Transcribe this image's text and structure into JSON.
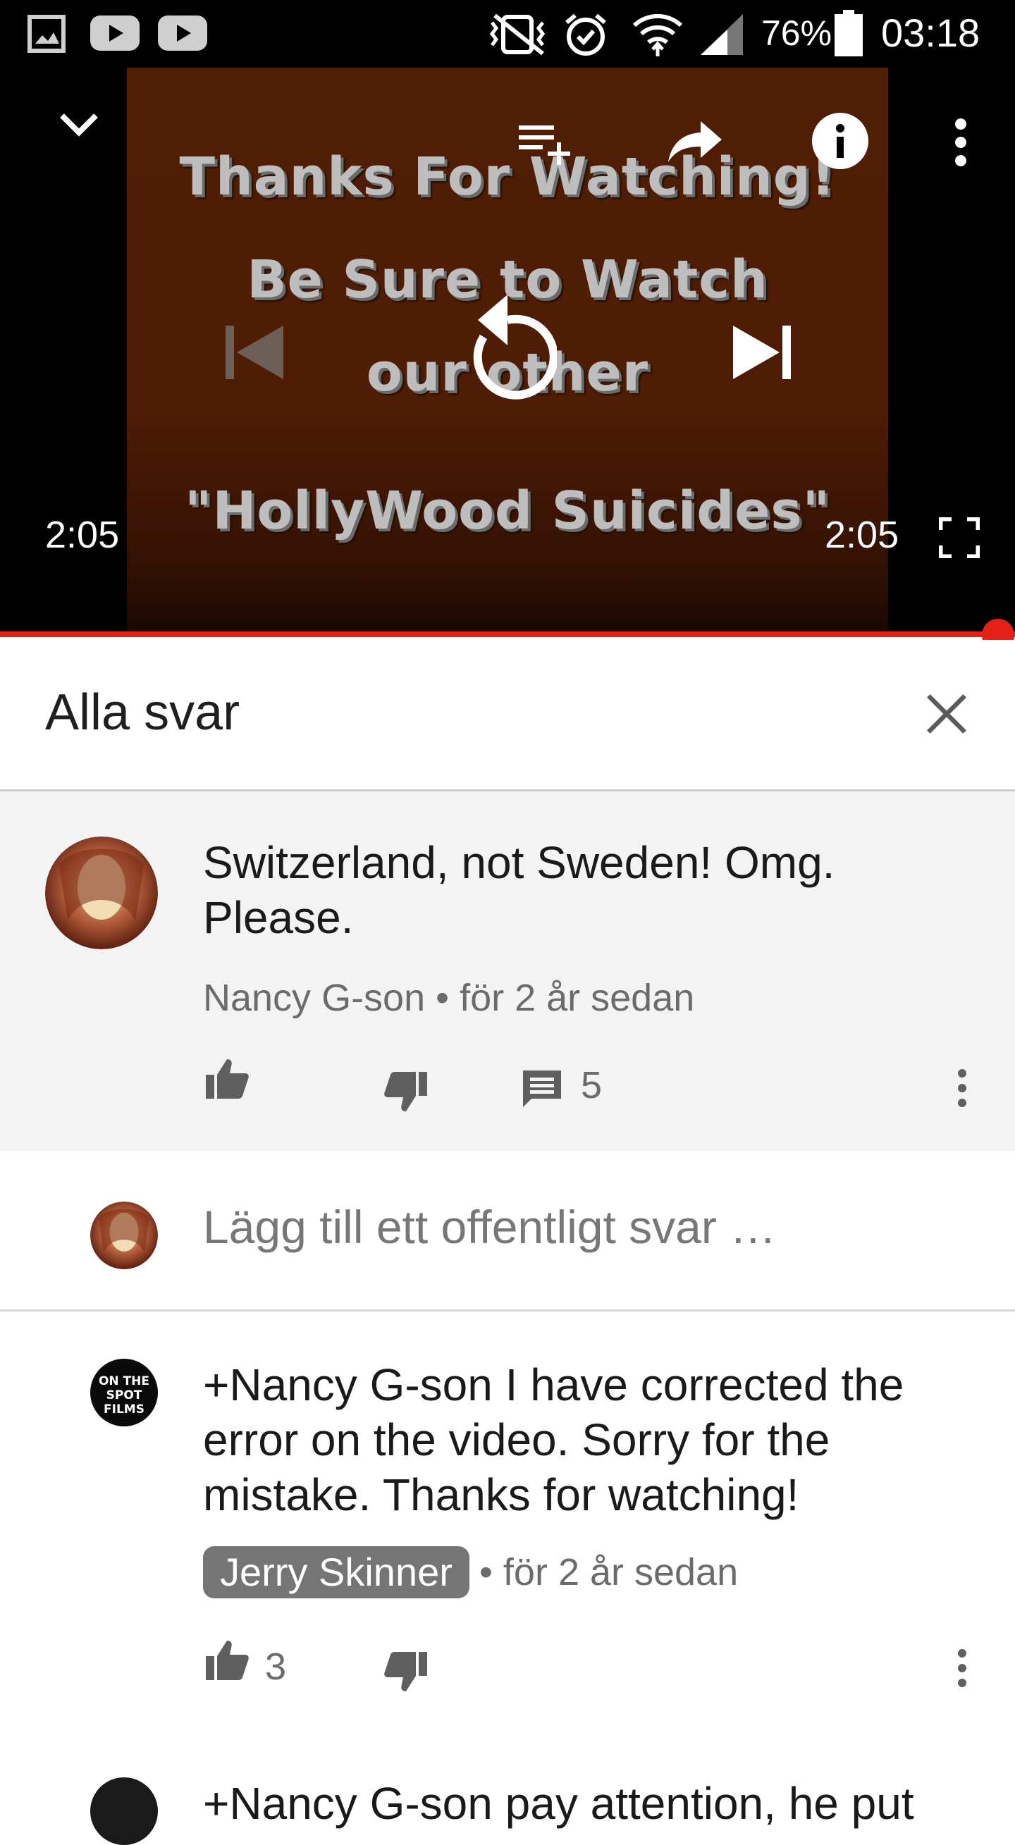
{
  "status_bar": {
    "battery_percent": "76%",
    "time": "03:18",
    "icons": [
      "gallery-icon",
      "youtube-icon",
      "youtube-icon",
      "vibrate-mute-icon",
      "alarm-icon",
      "wifi-icon",
      "signal-icon",
      "battery-icon"
    ]
  },
  "player": {
    "video_lines": [
      "Thanks For Watching!",
      "Be Sure to Watch",
      "our other",
      "\"HollyWood Suicides\""
    ],
    "current_time": "2:05",
    "duration": "2:05",
    "progress": 1.0,
    "accent_color": "#e52017",
    "controls": [
      "minimize-chevron-icon",
      "add-to-playlist-icon",
      "share-icon",
      "info-icon",
      "more-vert-icon",
      "previous-icon",
      "replay-icon",
      "next-icon",
      "fullscreen-icon"
    ]
  },
  "replies_panel": {
    "title": "Alla svar",
    "close_icon": "close-icon"
  },
  "parent_comment": {
    "text": "Switzerland, not Sweden! Omg. Please.",
    "author": "Nancy G-son",
    "age": "för 2 år sedan",
    "reply_count": "5"
  },
  "reply_input": {
    "placeholder": "Lägg till ett offentligt svar …"
  },
  "replies": [
    {
      "text": "+Nancy G-son I have corrected the error on the video. Sorry for the mistake. Thanks for watching!",
      "author": "Jerry Skinner",
      "age": "för 2 år sedan",
      "likes": "3",
      "avatar_text": "ON THE SPOT FILMS"
    },
    {
      "text": "+Nancy G-son pay attention, he put"
    }
  ]
}
